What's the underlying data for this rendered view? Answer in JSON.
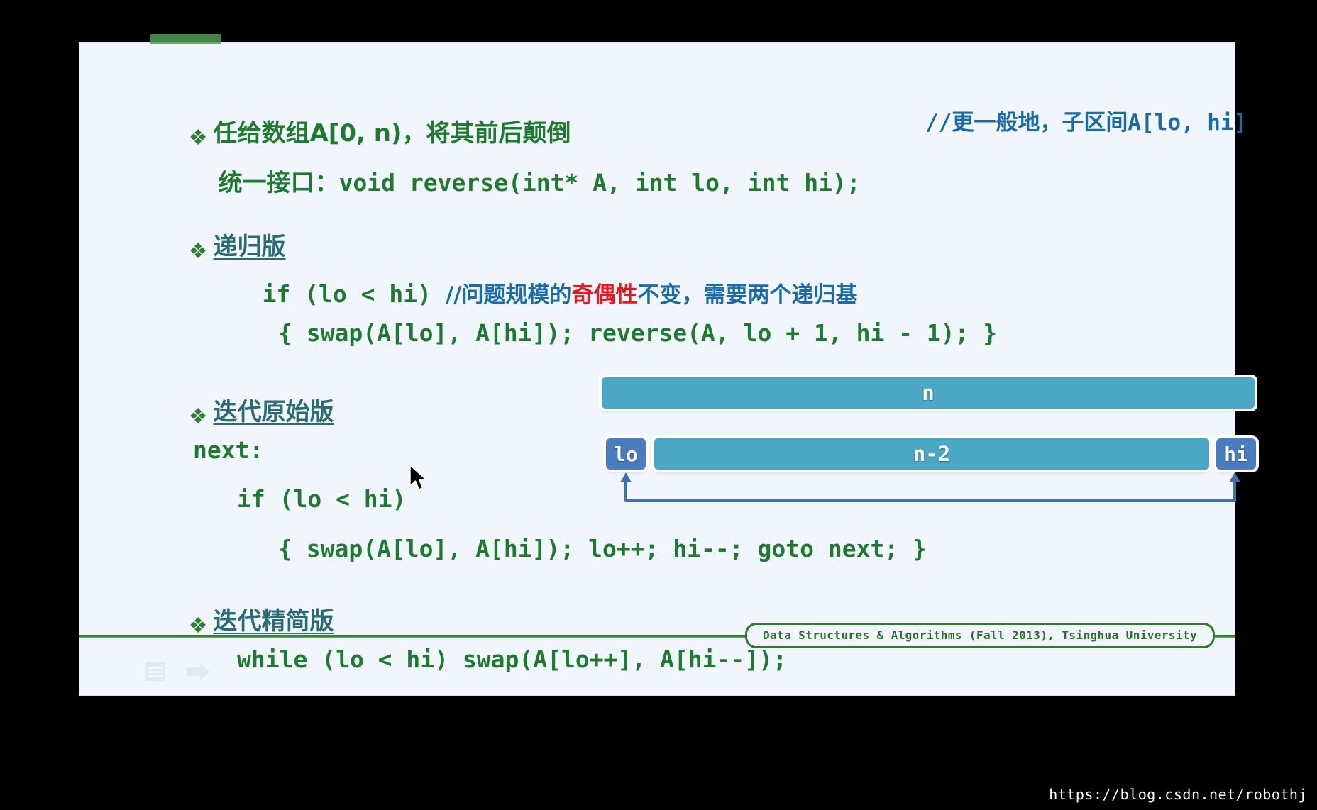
{
  "slide": {
    "title_line": {
      "bullet": "diamond-bullet",
      "text": "任给数组A[0, n)，将其前后颠倒",
      "right_comment": "//更一般地，子区间A[lo, hi]"
    },
    "interface_line": {
      "label": "统一接口：",
      "code": "void reverse(int* A, int lo, int hi);"
    },
    "sections": [
      {
        "heading": "递归版",
        "lines": [
          {
            "code": "if (lo < hi) ",
            "comment_pre": "//问题规模的",
            "comment_hl": "奇偶性",
            "comment_post": "不变，需要两个递归基"
          },
          {
            "code": "{ swap(A[lo], A[hi]); reverse(A, lo + 1, hi - 1); }"
          }
        ]
      },
      {
        "heading": "迭代原始版",
        "lines": [
          {
            "code": "next:"
          },
          {
            "code": "if (lo < hi)"
          },
          {
            "code": "{ swap(A[lo], A[hi]); lo++; hi--; goto next; }"
          }
        ]
      },
      {
        "heading": "迭代精简版",
        "lines": [
          {
            "code": "while (lo < hi) swap(A[lo++], A[hi--]);"
          }
        ]
      }
    ],
    "diagram": {
      "full_bar_label": "n",
      "inner_bar_label": "n-2",
      "left_marker": "lo",
      "right_marker": "hi",
      "arrow": "double-headed-swap-arrow"
    },
    "footer": {
      "badge": "Data Structures & Algorithms (Fall 2013), Tsinghua University"
    },
    "tray": {
      "notes_icon": "notes-icon",
      "next_icon": "next-arrow-icon"
    }
  },
  "watermark": "https://blog.csdn.net/robothj",
  "colors": {
    "slide_bg": "#f1f6fc",
    "green": "#1f7a31",
    "teal_heading": "#2a6b74",
    "blue_comment": "#1b6ba8",
    "red_highlight": "#e8161d",
    "bar_teal": "#4aa8c4",
    "marker_blue": "#4a7dc0",
    "footer_green": "#2f7a2f"
  }
}
